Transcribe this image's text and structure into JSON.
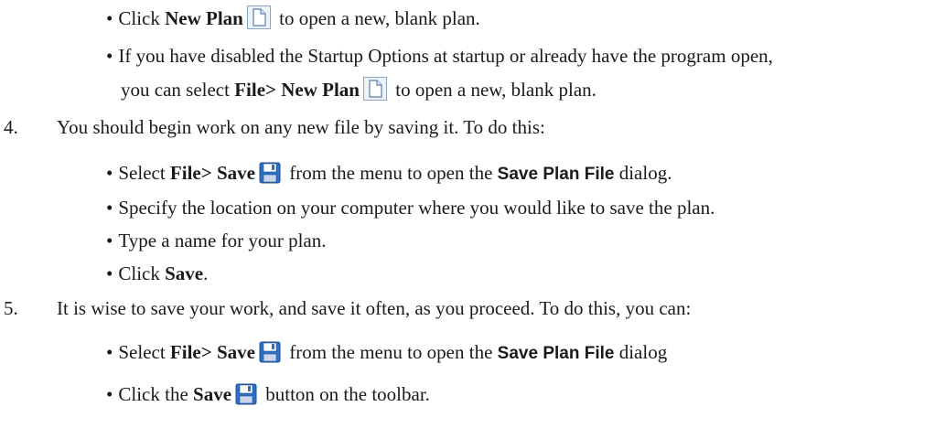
{
  "steps": {
    "new_plan_bullet": {
      "prefix": "Click ",
      "bold": "New Plan",
      "suffix": " to open a new, blank plan.",
      "icon": "new-document-icon"
    },
    "startup_bullet": {
      "text": "If you have disabled the Startup Options at startup or already have the program open,",
      "cont_prefix": "you can select ",
      "cont_bold": "File> New Plan",
      "cont_suffix": " to open a new, blank plan.",
      "icon": "new-document-icon"
    },
    "step4": {
      "number": "4.",
      "text": "You should begin work on any new file by saving it. To do this:",
      "bullets": [
        {
          "prefix": "Select ",
          "bold": "File> Save",
          "middle": " from the menu to open the ",
          "dialog": "Save Plan File",
          "suffix": " dialog.",
          "icon": "save-disk-icon"
        },
        {
          "text": "Specify the location on your computer where you would like to save the plan."
        },
        {
          "text": "Type a name for your plan."
        },
        {
          "prefix": "Click ",
          "bold": "Save",
          "suffix": "."
        }
      ]
    },
    "step5": {
      "number": "5.",
      "text": "It is wise to save your work, and save it often, as you proceed. To do this, you can:",
      "bullets": [
        {
          "prefix": "Select ",
          "bold": "File> Save",
          "middle": " from the menu to open the ",
          "dialog": "Save Plan File",
          "suffix": " dialog",
          "icon": "save-disk-icon"
        },
        {
          "prefix": "Click the ",
          "bold": "Save",
          "suffix": " button on the toolbar.",
          "icon": "save-disk-icon"
        }
      ]
    }
  },
  "bullet_char": "•",
  "colors": {
    "text": "#1a1a1a",
    "icon_border": "#6f8fb8",
    "disk_blue": "#2f6fc4"
  }
}
